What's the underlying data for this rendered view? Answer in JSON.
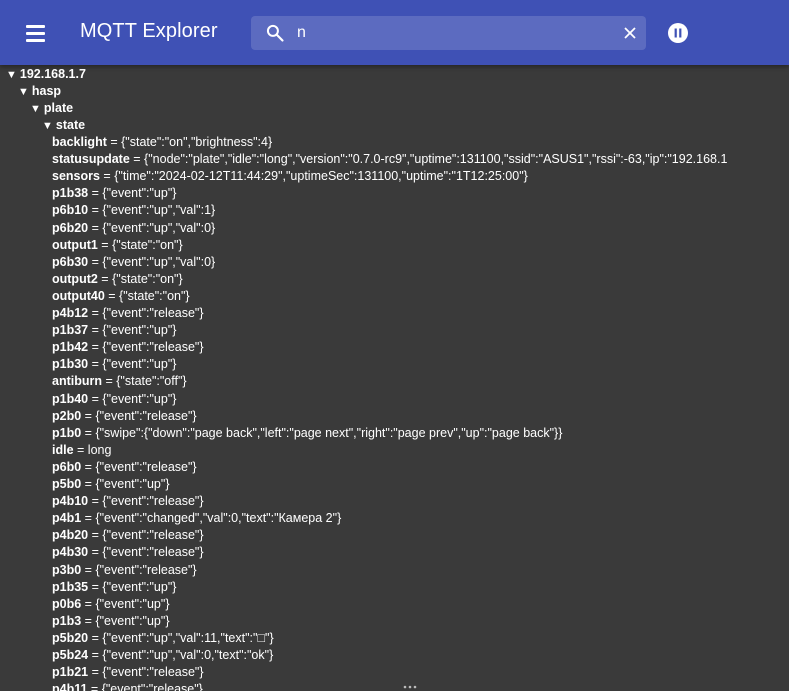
{
  "app": {
    "title": "MQTT Explorer",
    "icons": {
      "menu": "hamburger-menu-icon",
      "search": "search-icon",
      "clear": "close-icon",
      "pause": "pause-icon"
    },
    "colors": {
      "appbar": "#3f51b5",
      "search_bg": "#5c6bc0",
      "tree_bg": "#3a3a3a",
      "text": "#ffffff"
    }
  },
  "search": {
    "value": "n",
    "placeholder": ""
  },
  "tree": {
    "folders": [
      {
        "label": "192.168.1.7",
        "expanded": true
      },
      {
        "label": "hasp",
        "expanded": true
      },
      {
        "label": "plate",
        "expanded": true
      },
      {
        "label": "state",
        "expanded": true
      }
    ],
    "entries": [
      {
        "key": "backlight",
        "value": "{\"state\":\"on\",\"brightness\":4}"
      },
      {
        "key": "statusupdate",
        "value": "{\"node\":\"plate\",\"idle\":\"long\",\"version\":\"0.7.0-rc9\",\"uptime\":131100,\"ssid\":\"ASUS1\",\"rssi\":-63,\"ip\":\"192.168.1"
      },
      {
        "key": "sensors",
        "value": "{\"time\":\"2024-02-12T11:44:29\",\"uptimeSec\":131100,\"uptime\":\"1T12:25:00\"}"
      },
      {
        "key": "p1b38",
        "value": "{\"event\":\"up\"}"
      },
      {
        "key": "p6b10",
        "value": "{\"event\":\"up\",\"val\":1}"
      },
      {
        "key": "p6b20",
        "value": "{\"event\":\"up\",\"val\":0}"
      },
      {
        "key": "output1",
        "value": "{\"state\":\"on\"}"
      },
      {
        "key": "p6b30",
        "value": "{\"event\":\"up\",\"val\":0}"
      },
      {
        "key": "output2",
        "value": "{\"state\":\"on\"}"
      },
      {
        "key": "output40",
        "value": "{\"state\":\"on\"}"
      },
      {
        "key": "p4b12",
        "value": "{\"event\":\"release\"}"
      },
      {
        "key": "p1b37",
        "value": "{\"event\":\"up\"}"
      },
      {
        "key": "p1b42",
        "value": "{\"event\":\"release\"}"
      },
      {
        "key": "p1b30",
        "value": "{\"event\":\"up\"}"
      },
      {
        "key": "antiburn",
        "value": "{\"state\":\"off\"}"
      },
      {
        "key": "p1b40",
        "value": "{\"event\":\"up\"}"
      },
      {
        "key": "p2b0",
        "value": "{\"event\":\"release\"}"
      },
      {
        "key": "p1b0",
        "value": "{\"swipe\":{\"down\":\"page back\",\"left\":\"page next\",\"right\":\"page prev\",\"up\":\"page back\"}}"
      },
      {
        "key": "idle",
        "value": "long"
      },
      {
        "key": "p6b0",
        "value": "{\"event\":\"release\"}"
      },
      {
        "key": "p5b0",
        "value": "{\"event\":\"up\"}"
      },
      {
        "key": "p4b10",
        "value": "{\"event\":\"release\"}"
      },
      {
        "key": "p4b1",
        "value": "{\"event\":\"changed\",\"val\":0,\"text\":\"Камера 2\"}"
      },
      {
        "key": "p4b20",
        "value": "{\"event\":\"release\"}"
      },
      {
        "key": "p4b30",
        "value": "{\"event\":\"release\"}"
      },
      {
        "key": "p3b0",
        "value": "{\"event\":\"release\"}"
      },
      {
        "key": "p1b35",
        "value": "{\"event\":\"up\"}"
      },
      {
        "key": "p0b6",
        "value": "{\"event\":\"up\"}"
      },
      {
        "key": "p1b3",
        "value": "{\"event\":\"up\"}"
      },
      {
        "key": "p5b20",
        "value": "{\"event\":\"up\",\"val\":11,\"text\":\"□\"}"
      },
      {
        "key": "p5b24",
        "value": "{\"event\":\"up\",\"val\":0,\"text\":\"ok\"}"
      },
      {
        "key": "p1b21",
        "value": "{\"event\":\"release\"}"
      },
      {
        "key": "p4b11",
        "value": "{\"event\":\"release\"}"
      }
    ]
  }
}
